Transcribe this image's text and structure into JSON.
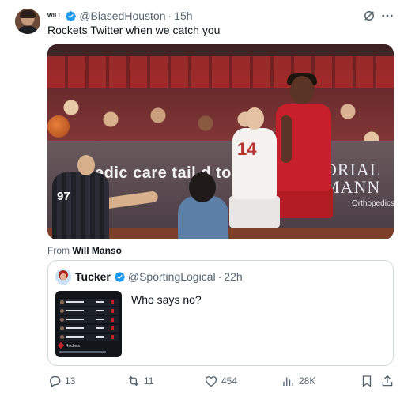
{
  "tweet": {
    "display_name": "WILL",
    "handle": "@BiasedHouston",
    "separator": "·",
    "time": "15h",
    "text": "Rockets Twitter when we catch you",
    "icons": {
      "verified": "verified-badge-icon",
      "grok": "grok-icon",
      "more": "more-icon"
    }
  },
  "media": {
    "ad_text": "edic care tail    d to",
    "ad_brand_line1": "ORIAL",
    "ad_brand_line2": "MANN",
    "ad_brand_sub": "Orthopedics",
    "ref_number": "97",
    "heat_number": "14"
  },
  "attribution": {
    "prefix": "From",
    "source": "Will Manso"
  },
  "quote": {
    "name": "Tucker",
    "handle": "@SportingLogical",
    "separator": "·",
    "time": "22h",
    "text": "Who says no?",
    "thumb_team": "Rockets"
  },
  "actions": {
    "replies": "13",
    "reposts": "11",
    "likes": "454",
    "views": "28K",
    "icons": [
      "reply-icon",
      "repost-icon",
      "like-icon",
      "views-icon",
      "bookmark-icon",
      "share-icon"
    ]
  },
  "colors": {
    "verified": "#1d9bf0",
    "secondary_text": "#536471",
    "border": "#cfd9de",
    "rockets_red": "#c8202a"
  }
}
